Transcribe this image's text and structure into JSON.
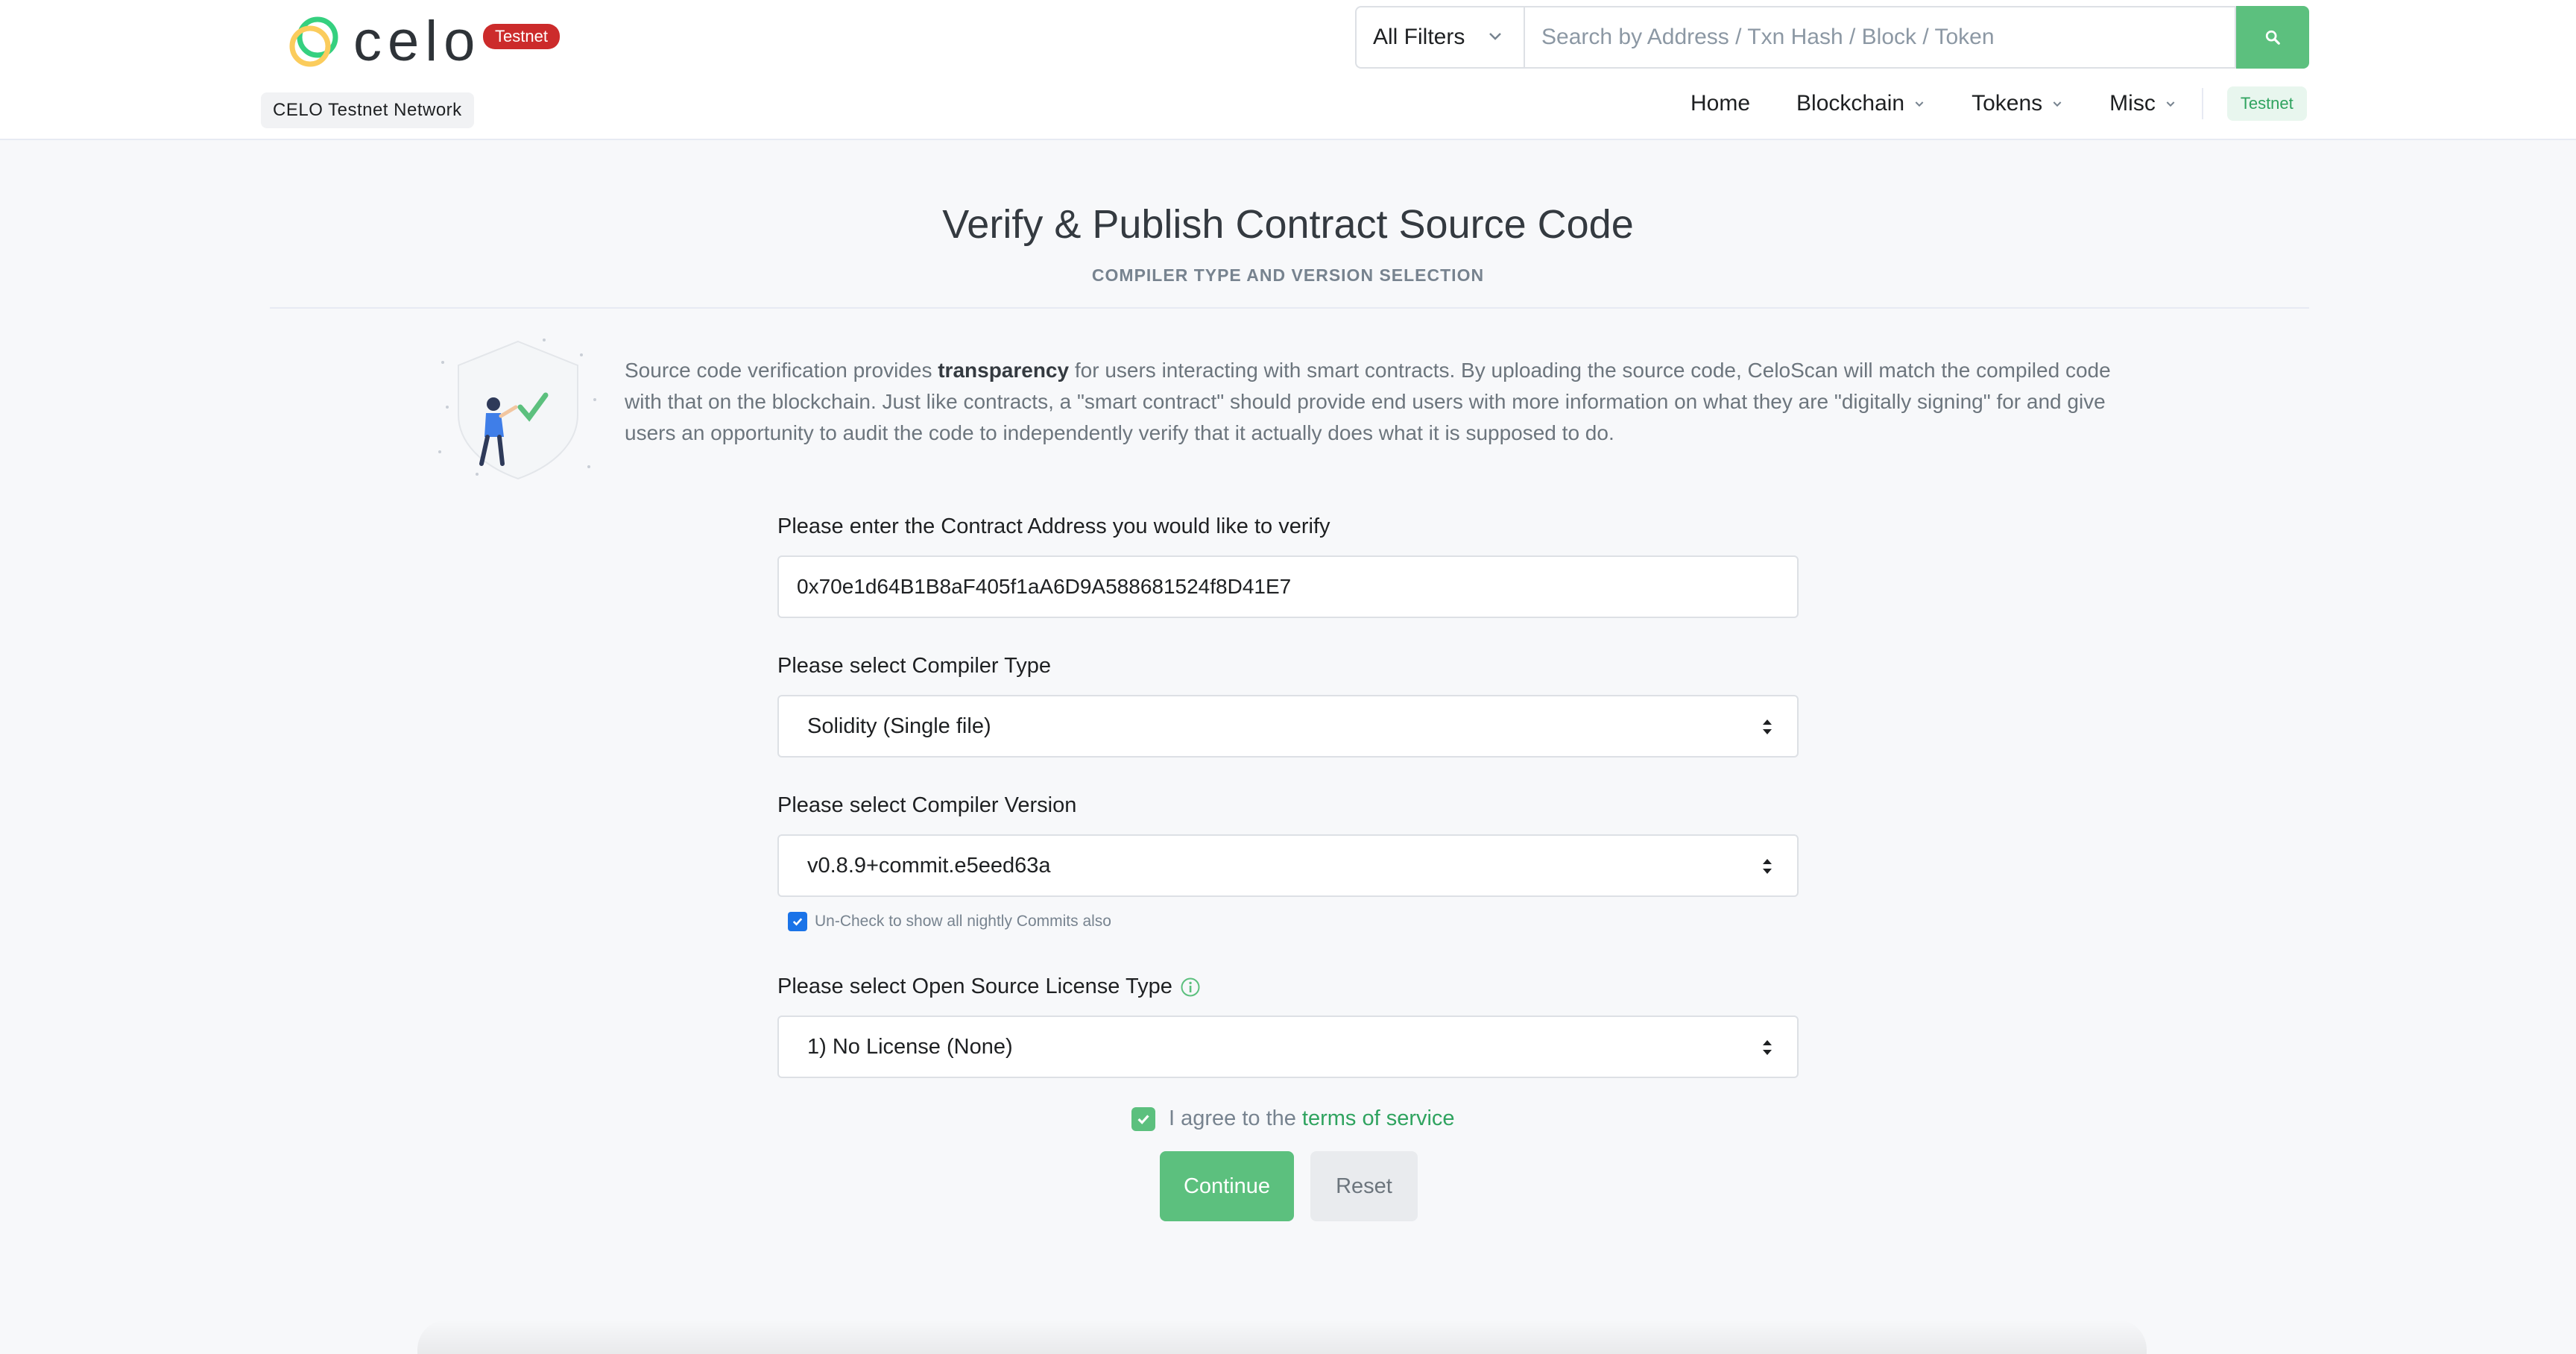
{
  "header": {
    "logo_text": "celo",
    "badge": "Testnet",
    "network": "CELO Testnet Network",
    "filter_label": "All Filters",
    "search_placeholder": "Search by Address / Txn Hash / Block / Token",
    "nav": {
      "home": "Home",
      "blockchain": "Blockchain",
      "tokens": "Tokens",
      "misc": "Misc",
      "testnet": "Testnet"
    }
  },
  "page": {
    "title": "Verify & Publish Contract Source Code",
    "subtitle": "COMPILER TYPE AND VERSION SELECTION",
    "intro_part1": "Source code verification provides ",
    "intro_bold": "transparency",
    "intro_part2": " for users interacting with smart contracts. By uploading the source code, CeloScan will match the compiled code with that on the blockchain. Just like contracts, a \"smart contract\" should provide end users with more information on what they are \"digitally signing\" for and give users an opportunity to audit the code to independently verify that it actually does what it is supposed to do."
  },
  "form": {
    "address_label": "Please enter the Contract Address you would like to verify",
    "address_value": "0x70e1d64B1B8aF405f1aA6D9A588681524f8D41E7",
    "compiler_type_label": "Please select Compiler Type",
    "compiler_type_value": "Solidity (Single file)",
    "compiler_version_label": "Please select Compiler Version",
    "compiler_version_value": "v0.8.9+commit.e5eed63a",
    "nightly_label": "Un-Check to show all nightly Commits also",
    "license_label": "Please select Open Source License Type",
    "license_value": "1) No License (None)",
    "agree_text": "I agree to the",
    "terms_link": "terms of service",
    "continue": "Continue",
    "reset": "Reset"
  },
  "colors": {
    "accent": "#5cc07e",
    "badge": "#cc2b2b"
  }
}
